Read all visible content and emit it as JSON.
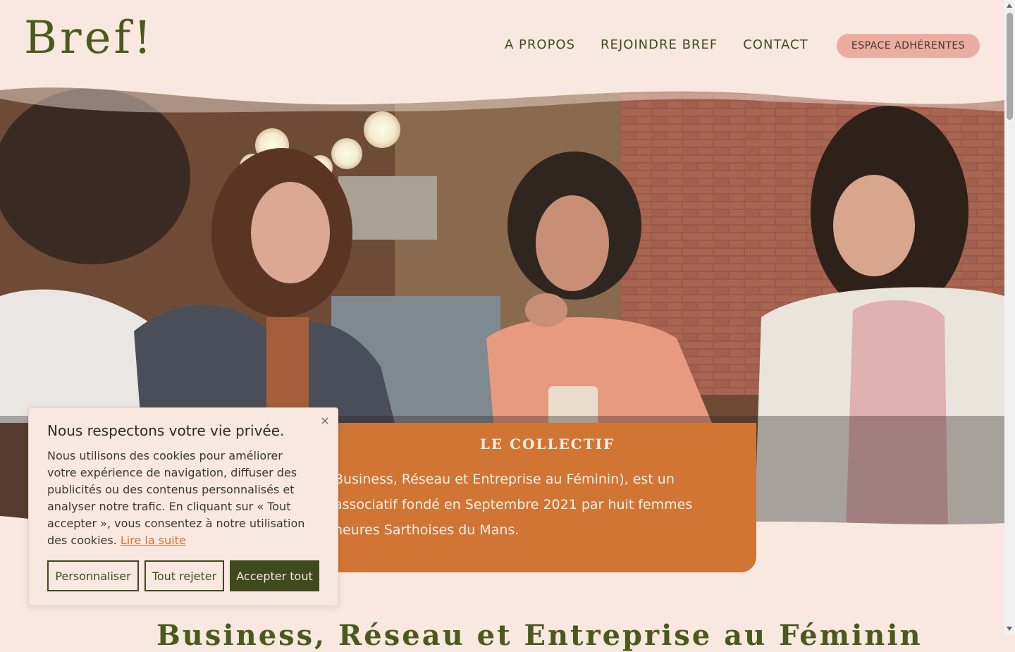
{
  "header": {
    "logo": "Bref!",
    "nav": [
      "A PROPOS",
      "REJOINDRE BREF",
      "CONTACT"
    ],
    "member_button": "ESPACE ADHÉRENTES"
  },
  "collectif": {
    "title": "LE COLLECTIF",
    "text": "Business, Réseau et Entreprise au Féminin), est un\nassociatif fondé en Septembre 2021 par huit femmes\nneures Sarthoises du Mans."
  },
  "bottom_heading": "Business, Réseau et Entreprise au Féminin",
  "cookie": {
    "title": "Nous respectons votre vie privée.",
    "text": "Nous utilisons des cookies pour améliorer votre expérience de navigation, diffuser des publicités ou des contenus personnalisés et analyser notre trafic. En cliquant sur « Tout accepter », vous consentez à notre utilisation des cookies.",
    "link": "Lire la suite",
    "close": "×",
    "buttons": {
      "customize": "Personnaliser",
      "reject": "Tout rejeter",
      "accept": "Accepter tout"
    }
  },
  "colors": {
    "background": "#f8e8df",
    "accent_orange": "#d17535",
    "olive": "#3f4a1d",
    "pink_button": "#ecaca1"
  }
}
